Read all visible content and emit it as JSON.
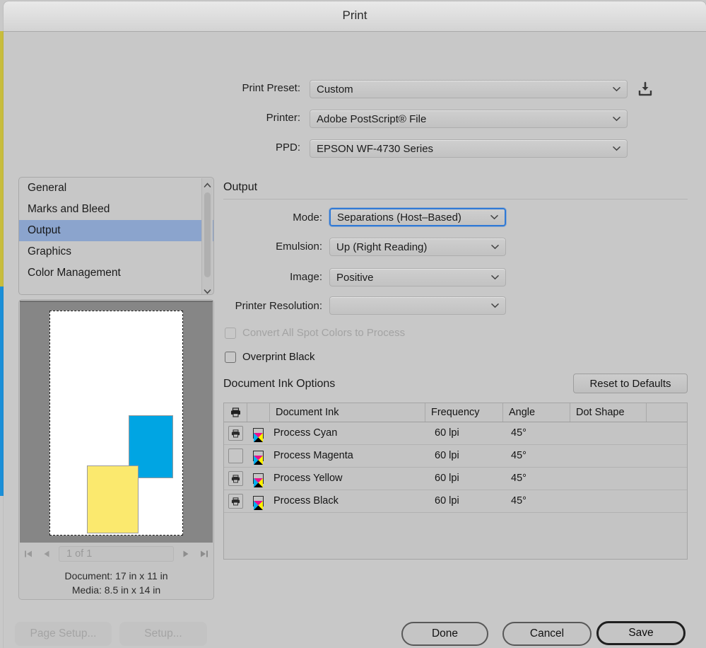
{
  "window": {
    "title": "Print"
  },
  "top_fields": [
    {
      "label": "Print Preset:",
      "value": "Custom"
    },
    {
      "label": "Printer:",
      "value": "Adobe PostScript® File"
    },
    {
      "label": "PPD:",
      "value": "EPSON WF-4730 Series"
    }
  ],
  "preset_save_icon": "save-preset-icon",
  "nav": {
    "items": [
      {
        "label": "General",
        "selected": false
      },
      {
        "label": "Marks and Bleed",
        "selected": false
      },
      {
        "label": "Output",
        "selected": true
      },
      {
        "label": "Graphics",
        "selected": false
      },
      {
        "label": "Color Management",
        "selected": false
      }
    ],
    "scroll_up_icon": "chevron-up-icon",
    "scroll_down_icon": "chevron-down-icon"
  },
  "preview": {
    "page_nav": {
      "first_icon": "first-page-icon",
      "prev_icon": "previous-page-icon",
      "next_icon": "next-page-icon",
      "last_icon": "last-page-icon",
      "page_value": "1 of 1"
    },
    "document_label": "Document:",
    "document_size": "17 in x 11 in",
    "media_label": "Media:",
    "media_size": "8.5 in x 14 in",
    "colors": {
      "cyan_shape": "#00a5e3",
      "yellow_shape": "#fbe96e",
      "paper": "#ffffff",
      "backdrop": "#868686"
    }
  },
  "output": {
    "section_title": "Output",
    "fields": [
      {
        "label": "Mode:",
        "value": "Separations (Host–Based)",
        "focused": true,
        "enabled": true
      },
      {
        "label": "Emulsion:",
        "value": "Up (Right Reading)",
        "focused": false,
        "enabled": true
      },
      {
        "label": "Image:",
        "value": "Positive",
        "focused": false,
        "enabled": true
      },
      {
        "label": "Printer Resolution:",
        "value": "",
        "focused": false,
        "enabled": true
      }
    ],
    "checkboxes": [
      {
        "label": "Convert All Spot Colors to Process",
        "checked": false,
        "enabled": false
      },
      {
        "label": "Overprint Black",
        "checked": false,
        "enabled": true
      }
    ]
  },
  "ink_options": {
    "title": "Document Ink Options",
    "reset_button": "Reset to Defaults",
    "columns": [
      "",
      "",
      "Document Ink",
      "Frequency",
      "Angle",
      "Dot Shape",
      ""
    ],
    "printer_header_icon": "printer-icon",
    "rows": [
      {
        "print": true,
        "swatch": "cmyk-swatch-icon",
        "name": "Process Cyan",
        "frequency": "60 lpi",
        "angle": "45°",
        "dot_shape": ""
      },
      {
        "print": false,
        "swatch": "cmyk-swatch-icon",
        "name": "Process Magenta",
        "frequency": "60 lpi",
        "angle": "45°",
        "dot_shape": ""
      },
      {
        "print": true,
        "swatch": "cmyk-swatch-icon",
        "name": "Process Yellow",
        "frequency": "60 lpi",
        "angle": "45°",
        "dot_shape": ""
      },
      {
        "print": true,
        "swatch": "cmyk-swatch-icon",
        "name": "Process Black",
        "frequency": "60 lpi",
        "angle": "45°",
        "dot_shape": ""
      }
    ]
  },
  "footer": {
    "page_setup": "Page Setup...",
    "setup": "Setup...",
    "done": "Done",
    "cancel": "Cancel",
    "save": "Save"
  }
}
